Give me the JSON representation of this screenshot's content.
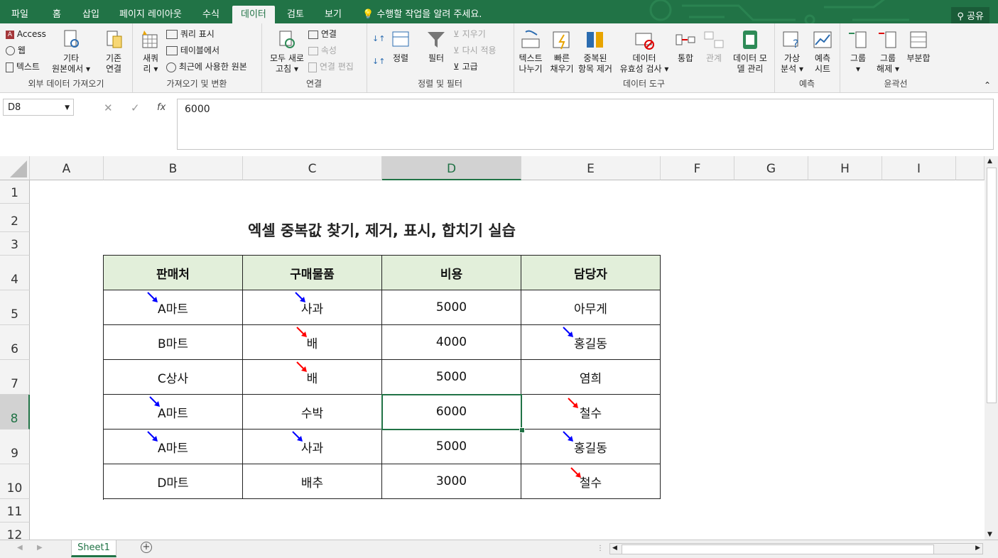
{
  "tabs": [
    "파일",
    "홈",
    "삽입",
    "페이지 레이아웃",
    "수식",
    "데이터",
    "검토",
    "보기"
  ],
  "active_tab": "데이터",
  "tell_me": "수행할 작업을 알려 주세요.",
  "share": "공유",
  "ribbon": {
    "external": {
      "access": "Access",
      "web": "웹",
      "text": "텍스트",
      "other1": "기타",
      "other2": "원본에서",
      "label": "외부 데이터 가져오기"
    },
    "getx": {
      "existing1": "기존",
      "existing2": "연결",
      "new1": "새쿼",
      "new2": "리",
      "show_query": "쿼리 표시",
      "from_table": "테이블에서",
      "recent": "최근에 사용한 원본",
      "label": "가져오기 및 변환"
    },
    "conn": {
      "refresh1": "모두 새로",
      "refresh2": "고침",
      "connections": "연결",
      "properties": "속성",
      "edit_links": "연결 편집",
      "label": "연결"
    },
    "sort": {
      "sort": "정렬",
      "filter": "필터",
      "clear": "지우기",
      "reapply": "다시 적용",
      "advanced": "고급",
      "label": "정렬 및 필터"
    },
    "tools": {
      "t2c1": "텍스트",
      "t2c2": "나누기",
      "flash1": "빠른",
      "flash2": "채우기",
      "dup1": "중복된",
      "dup2": "항목 제거",
      "val1": "데이터",
      "val2": "유효성 검사",
      "cons": "통합",
      "rel": "관계",
      "model1": "데이터 모",
      "model2": "델 관리",
      "label": "데이터 도구"
    },
    "forecast": {
      "whatif1": "가상",
      "whatif2": "분석",
      "sheet1": "예측",
      "sheet2": "시트",
      "label": "예측"
    },
    "outline": {
      "group": "그룹",
      "ungroup1": "그룹",
      "ungroup2": "해제",
      "subtotal": "부분합",
      "label": "윤곽선"
    }
  },
  "namebox": "D8",
  "formula": "6000",
  "columns": [
    "A",
    "B",
    "C",
    "D",
    "E",
    "F",
    "G",
    "H",
    "I"
  ],
  "rows": [
    "1",
    "2",
    "3",
    "4",
    "5",
    "6",
    "7",
    "8",
    "9",
    "10",
    "11",
    "12"
  ],
  "title": "엑셀 중복값 찾기, 제거, 표시, 합치기 실습",
  "table": {
    "headers": [
      "판매처",
      "구매물품",
      "비용",
      "담당자"
    ],
    "rows": [
      [
        "A마트",
        "사과",
        "5000",
        "아무게"
      ],
      [
        "B마트",
        "배",
        "4000",
        "홍길동"
      ],
      [
        "C상사",
        "배",
        "5000",
        "염희"
      ],
      [
        "A마트",
        "수박",
        "6000",
        "철수"
      ],
      [
        "A마트",
        "사과",
        "5000",
        "홍길동"
      ],
      [
        "D마트",
        "배추",
        "3000",
        "철수"
      ]
    ]
  },
  "sheet_tab": "Sheet1",
  "colors": {
    "accent": "#217346",
    "header_fill": "#e2efda",
    "arrow_blue": "#0000ff",
    "arrow_red": "#ff0000"
  }
}
